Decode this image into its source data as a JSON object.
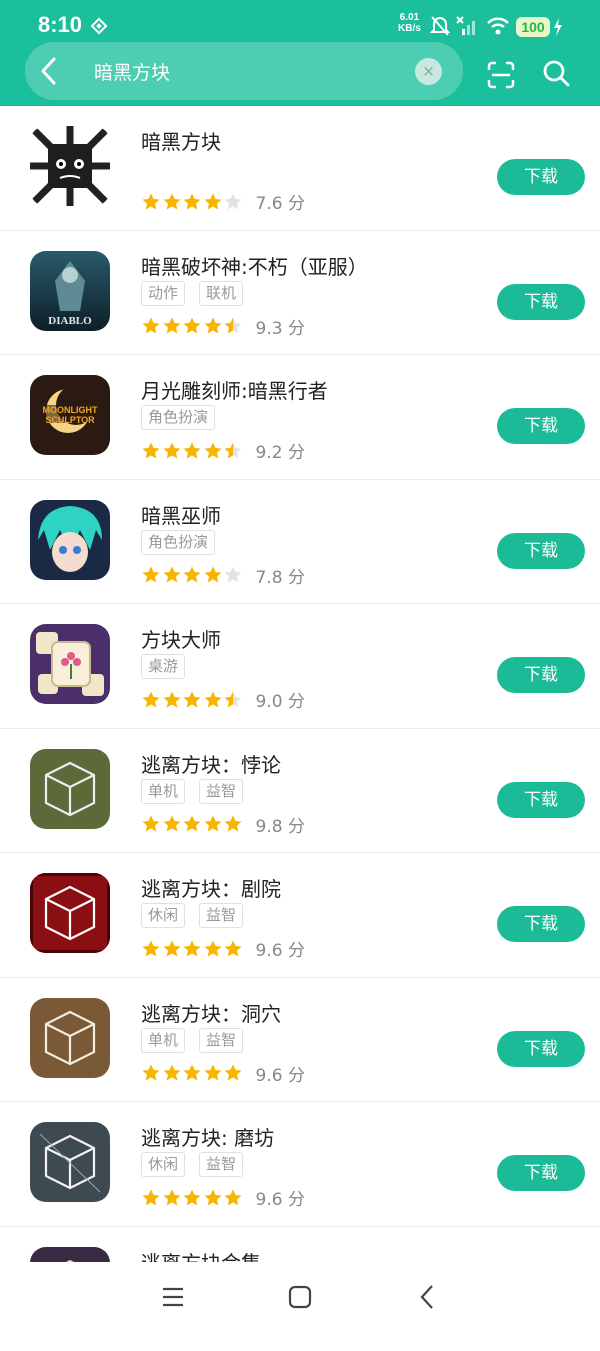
{
  "status": {
    "time": "8:10",
    "speed_value": "6.01",
    "speed_unit": "KB/s",
    "battery": "100"
  },
  "search": {
    "query": "暗黑方块",
    "clear_symbol": "×"
  },
  "results": [
    {
      "name": "暗黑方块",
      "tags": [],
      "stars": 4,
      "score": "7.6 分",
      "button": "下载"
    },
    {
      "name": "暗黑破坏神:不朽（亚服）",
      "tags": [
        "动作",
        "联机"
      ],
      "stars": 4.5,
      "score": "9.3 分",
      "button": "下载",
      "icon_text": "DIABLO"
    },
    {
      "name": "月光雕刻师:暗黑行者",
      "tags": [
        "角色扮演"
      ],
      "stars": 4.5,
      "score": "9.2 分",
      "button": "下载",
      "icon_text": "MOONLIGHT SCULPTOR"
    },
    {
      "name": "暗黑巫师",
      "tags": [
        "角色扮演"
      ],
      "stars": 4,
      "score": "7.8 分",
      "button": "下载"
    },
    {
      "name": "方块大师",
      "tags": [
        "桌游"
      ],
      "stars": 4.5,
      "score": "9.0 分",
      "button": "下载"
    },
    {
      "name": "逃离方块：悖论",
      "tags": [
        "单机",
        "益智"
      ],
      "stars": 5,
      "score": "9.8 分",
      "button": "下载"
    },
    {
      "name": "逃离方块：剧院",
      "tags": [
        "休闲",
        "益智"
      ],
      "stars": 5,
      "score": "9.6 分",
      "button": "下载"
    },
    {
      "name": "逃离方块：洞穴",
      "tags": [
        "单机",
        "益智"
      ],
      "stars": 5,
      "score": "9.6 分",
      "button": "下载"
    },
    {
      "name": "逃离方块: 磨坊",
      "tags": [
        "休闲",
        "益智"
      ],
      "stars": 5,
      "score": "9.6 分",
      "button": "下载"
    },
    {
      "name": "逃离方块合集",
      "tags": [],
      "stars": 0,
      "score": "",
      "button": ""
    }
  ],
  "colors": {
    "brand": "#1bbf9b",
    "button": "#1cbb98",
    "star_on": "#f7b500",
    "star_off": "#e3e3e3"
  }
}
